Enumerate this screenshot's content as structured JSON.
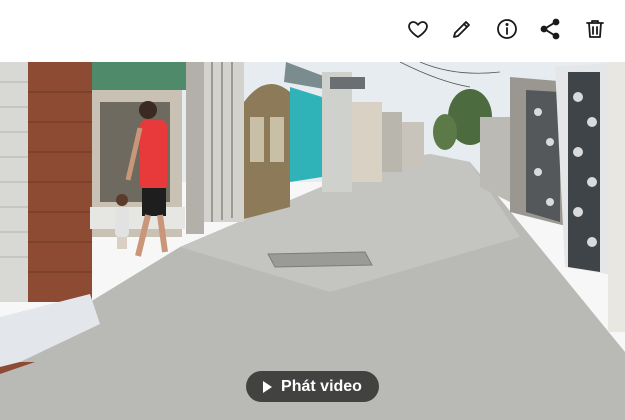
{
  "toolbar": {
    "icons": [
      "heart-icon",
      "pencil-icon",
      "info-icon",
      "share-icon",
      "trash-icon"
    ]
  },
  "video": {
    "play_label": "Phát video"
  },
  "colors": {
    "sky": "#e8edf0",
    "road": "#b8b8b6",
    "brick": "#8b4a32",
    "teal": "#2fb3b8",
    "shirt": "#e83a3a"
  }
}
